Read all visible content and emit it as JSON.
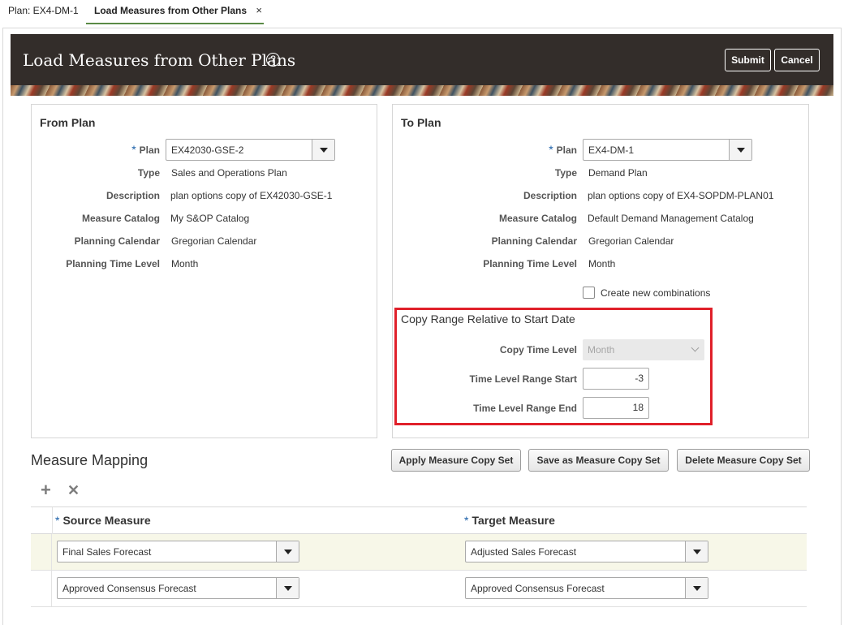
{
  "tabs": [
    {
      "label": "Plan: EX4-DM-1"
    },
    {
      "label": "Load Measures from Other Plans",
      "close": "×"
    }
  ],
  "header": {
    "title": "Load Measures from Other Plans",
    "help": "?",
    "submit_label": "Submit",
    "cancel_label": "Cancel"
  },
  "from_plan": {
    "title": "From Plan",
    "plan_label": "Plan",
    "plan_value": "EX42030-GSE-2",
    "type_label": "Type",
    "type_value": "Sales and Operations Plan",
    "description_label": "Description",
    "description_value": "plan options copy of EX42030-GSE-1",
    "catalog_label": "Measure Catalog",
    "catalog_value": "My S&OP Catalog",
    "calendar_label": "Planning Calendar",
    "calendar_value": "Gregorian Calendar",
    "time_level_label": "Planning Time Level",
    "time_level_value": "Month"
  },
  "to_plan": {
    "title": "To Plan",
    "plan_label": "Plan",
    "plan_value": "EX4-DM-1",
    "type_label": "Type",
    "type_value": "Demand Plan",
    "description_label": "Description",
    "description_value": "plan options copy of EX4-SOPDM-PLAN01",
    "catalog_label": "Measure Catalog",
    "catalog_value": "Default Demand Management Catalog",
    "calendar_label": "Planning Calendar",
    "calendar_value": "Gregorian Calendar",
    "time_level_label": "Planning Time Level",
    "time_level_value": "Month",
    "create_combinations_label": "Create new combinations",
    "create_combinations_checked": false
  },
  "copy_range": {
    "title": "Copy Range Relative to Start Date",
    "copy_time_level_label": "Copy Time Level",
    "copy_time_level_value": "Month",
    "range_start_label": "Time Level Range Start",
    "range_start_value": "-3",
    "range_end_label": "Time Level Range End",
    "range_end_value": "18"
  },
  "measure_mapping": {
    "title": "Measure Mapping",
    "apply_label": "Apply Measure Copy Set",
    "save_label": "Save as Measure Copy Set",
    "delete_label": "Delete Measure Copy Set",
    "add_icon": "+",
    "remove_icon": "✕",
    "source_header": "Source Measure",
    "target_header": "Target Measure",
    "rows": [
      {
        "source": "Final Sales Forecast",
        "target": "Adjusted Sales Forecast"
      },
      {
        "source": "Approved Consensus Forecast",
        "target": "Approved Consensus Forecast"
      }
    ]
  },
  "required_mark": "*",
  "colors": {
    "header_bg": "#332d2a",
    "highlight_border": "#e0202a",
    "required": "#1a5fa8",
    "active_tab_underline": "#5a8a46",
    "selected_row": "#f7f7e8"
  }
}
